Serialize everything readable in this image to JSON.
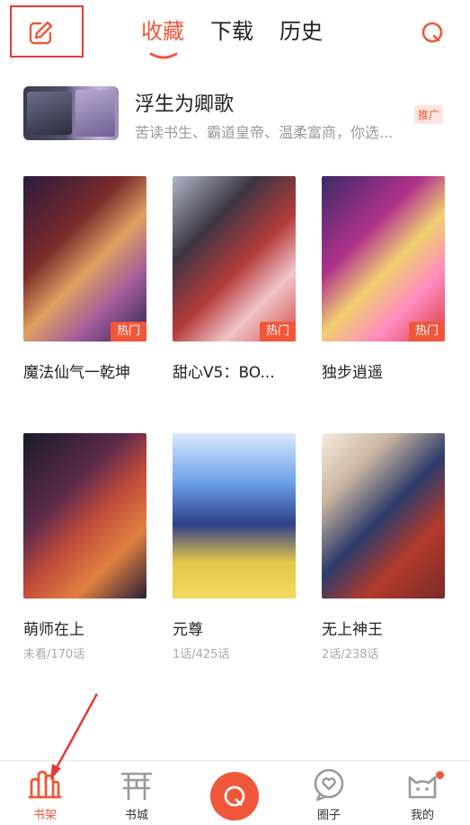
{
  "header": {
    "tabs": [
      {
        "label": "收藏",
        "active": true
      },
      {
        "label": "下载",
        "active": false
      },
      {
        "label": "历史",
        "active": false
      }
    ],
    "edit_icon": "edit-icon",
    "search_icon": "search-icon"
  },
  "promo": {
    "title": "浮生为卿歌",
    "desc": "苦读书生、霸道皇帝、温柔富商，你选...",
    "badge": "推广"
  },
  "books": [
    {
      "title": "魔法仙气一乾坤",
      "badge": "热门",
      "progress": ""
    },
    {
      "title": "甜心V5：BO...",
      "badge": "热门",
      "progress": ""
    },
    {
      "title": "独步逍遥",
      "badge": "热门",
      "progress": ""
    },
    {
      "title": "萌师在上",
      "badge": "",
      "progress": "未看/170话"
    },
    {
      "title": "元尊",
      "badge": "",
      "progress": "1话/425话"
    },
    {
      "title": "无上神王",
      "badge": "",
      "progress": "2话/238话"
    }
  ],
  "bottom_nav": [
    {
      "label": "书架",
      "icon": "bookshelf-icon",
      "active": true
    },
    {
      "label": "书城",
      "icon": "gate-icon",
      "active": false
    },
    {
      "label": "",
      "icon": "search-icon",
      "active": false
    },
    {
      "label": "圈子",
      "icon": "chat-heart-icon",
      "active": false
    },
    {
      "label": "我的",
      "icon": "cat-icon",
      "active": false
    }
  ],
  "colors": {
    "accent": "#f0573a",
    "annotation": "#e53935"
  }
}
